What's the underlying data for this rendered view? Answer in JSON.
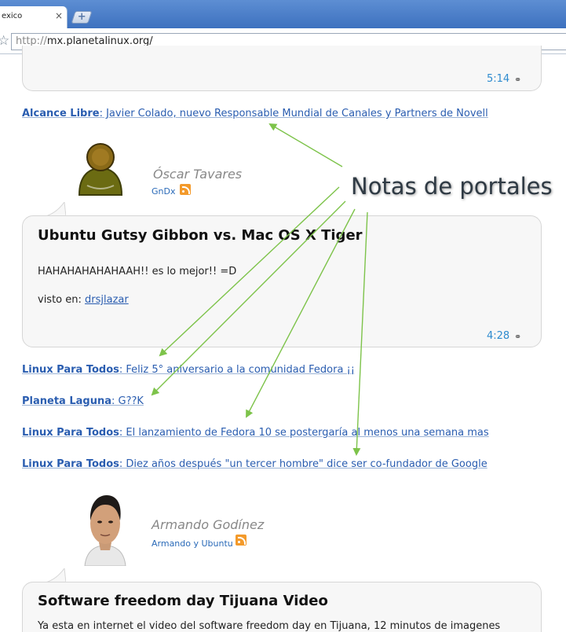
{
  "browser": {
    "tab_title": "exico",
    "tab_close": "×",
    "new_tab": "+",
    "url_scheme": "http://",
    "url_host": "mx.planetalinux.org/"
  },
  "top_post": {
    "time": "5:14"
  },
  "link_alcance": {
    "source": "Alcance Libre",
    "title": ": Javier Colado, nuevo Responsable Mundial de Canales y Partners de Novell"
  },
  "author1": {
    "name": "Óscar Tavares",
    "blog": "GnDx"
  },
  "post1": {
    "title": "Ubuntu Gutsy Gibbon vs. Mac OS X Tiger",
    "body": "HAHAHAHAHAHAAH!! es lo mejor!! =D",
    "via_label": "visto en: ",
    "via_link": "drsjlazar",
    "time": "4:28"
  },
  "links": [
    {
      "source": "Linux Para Todos",
      "title": ": Feliz 5° aniversario a la comunidad Fedora ¡¡"
    },
    {
      "source": "Planeta Laguna",
      "title": ": G??K"
    },
    {
      "source": "Linux Para Todos",
      "title": ": El lanzamiento de Fedora 10 se postergaría al menos una semana mas"
    },
    {
      "source": "Linux Para Todos",
      "title": ": Diez años después \"un tercer hombre\" dice ser co-fundador de Google"
    }
  ],
  "author2": {
    "name": "Armando Godínez",
    "blog": "Armando y Ubuntu"
  },
  "post2": {
    "title": "Software freedom day Tijuana Video",
    "body": "Ya esta en internet el video del software freedom day en Tijuana, 12 minutos de imagenes"
  },
  "annotation": {
    "text": "Notas de portales",
    "color": "#2f3a44",
    "arrow_color": "#7dc34a"
  }
}
